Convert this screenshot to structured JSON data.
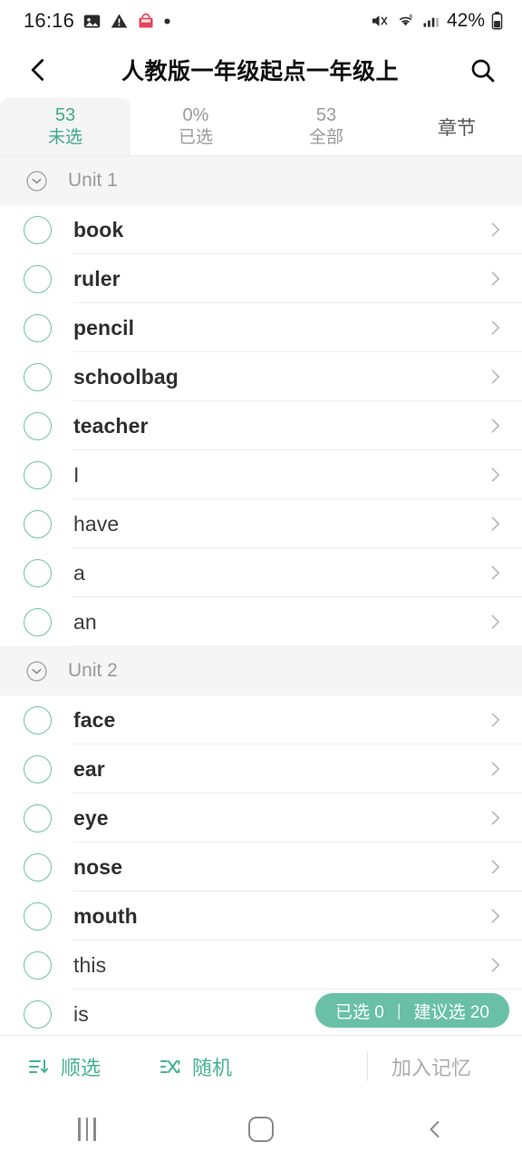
{
  "statusbar": {
    "time": "16:16",
    "left_icons": [
      "photo-icon",
      "warning-icon",
      "app-icon",
      "dot-icon"
    ],
    "right_icons": [
      "mute-icon",
      "wifi-icon",
      "signal-icon"
    ],
    "battery_text": "42%"
  },
  "header": {
    "back_icon": "chevron-left-icon",
    "title": "人教版一年级起点一年级上",
    "search_icon": "search-icon"
  },
  "tabs": [
    {
      "top": "53",
      "bottom": "未选",
      "active": true
    },
    {
      "top": "0%",
      "bottom": "已选",
      "active": false
    },
    {
      "top": "53",
      "bottom": "全部",
      "active": false
    },
    {
      "single": "章节",
      "active": false
    }
  ],
  "list": [
    {
      "type": "unit",
      "label": "Unit 1",
      "icon": "chevron-down-circle-icon"
    },
    {
      "type": "word",
      "text": "book",
      "bold": true
    },
    {
      "type": "word",
      "text": "ruler",
      "bold": true
    },
    {
      "type": "word",
      "text": "pencil",
      "bold": true
    },
    {
      "type": "word",
      "text": "schoolbag",
      "bold": true
    },
    {
      "type": "word",
      "text": "teacher",
      "bold": true
    },
    {
      "type": "word",
      "text": "I",
      "bold": false
    },
    {
      "type": "word",
      "text": "have",
      "bold": false
    },
    {
      "type": "word",
      "text": "a",
      "bold": false
    },
    {
      "type": "word",
      "text": "an",
      "bold": false
    },
    {
      "type": "unit",
      "label": "Unit 2",
      "icon": "chevron-down-circle-icon"
    },
    {
      "type": "word",
      "text": "face",
      "bold": true
    },
    {
      "type": "word",
      "text": "ear",
      "bold": true
    },
    {
      "type": "word",
      "text": "eye",
      "bold": true
    },
    {
      "type": "word",
      "text": "nose",
      "bold": true
    },
    {
      "type": "word",
      "text": "mouth",
      "bold": true
    },
    {
      "type": "word",
      "text": "this",
      "bold": false
    },
    {
      "type": "word",
      "text": "is",
      "bold": false
    }
  ],
  "badge": {
    "selected_label": "已选 0",
    "separator": "|",
    "suggest_label": "建议选 20"
  },
  "toolbar": {
    "sort_label": "顺选",
    "sort_icon": "sort-descending-icon",
    "random_label": "随机",
    "random_icon": "shuffle-icon",
    "action_label": "加入记忆"
  },
  "navbar": {
    "recents": "recents-icon",
    "home": "home-icon",
    "back": "back-icon"
  },
  "colors": {
    "accent": "#46b394",
    "badge_bg": "#69c0a7",
    "circle_border": "#6ec2a8",
    "muted": "#9a9a9a"
  }
}
